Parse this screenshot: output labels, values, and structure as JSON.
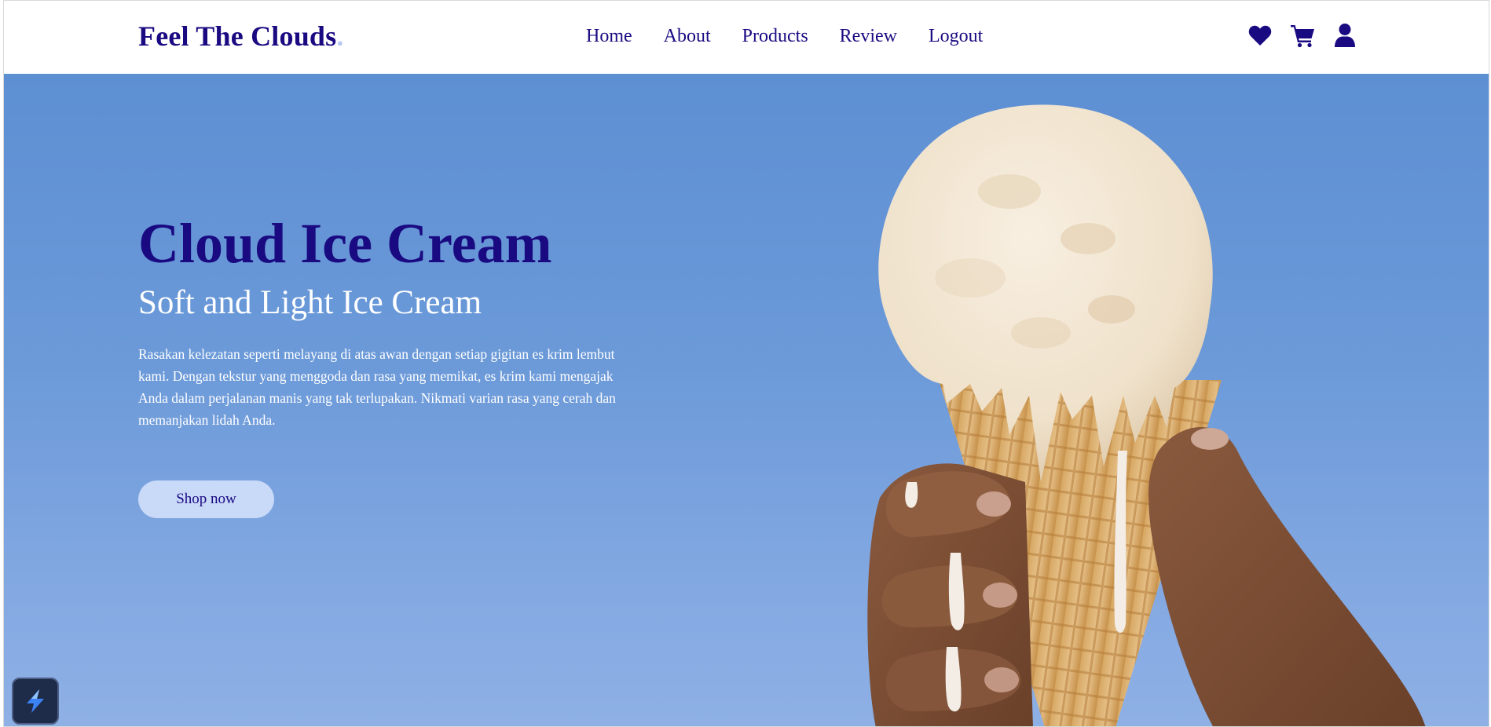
{
  "brand": {
    "name": "Feel The Clouds",
    "dot": "."
  },
  "nav": {
    "links": [
      {
        "label": "Home"
      },
      {
        "label": "About"
      },
      {
        "label": "Products"
      },
      {
        "label": "Review"
      },
      {
        "label": "Logout"
      }
    ],
    "icons": [
      "heart-icon",
      "cart-icon",
      "user-icon"
    ]
  },
  "hero": {
    "title": "Cloud Ice Cream",
    "subtitle": "Soft and Light Ice Cream",
    "text": "Rasakan kelezatan seperti melayang di atas awan dengan setiap gigitan es krim lembut kami. Dengan tekstur yang menggoda dan rasa yang memikat, es krim kami mengajak Anda dalam perjalanan manis yang tak terlupakan. Nikmati varian rasa yang cerah dan memanjakan lidah Anda.",
    "cta": "Shop now",
    "image": "ice-cream-cone-in-hand"
  },
  "floating_widget": {
    "icon": "lightning-app-icon"
  },
  "colors": {
    "primary": "#1a0a82",
    "sky": "#6c9ad9",
    "button_bg": "#c9d9f8",
    "white": "#ffffff"
  }
}
